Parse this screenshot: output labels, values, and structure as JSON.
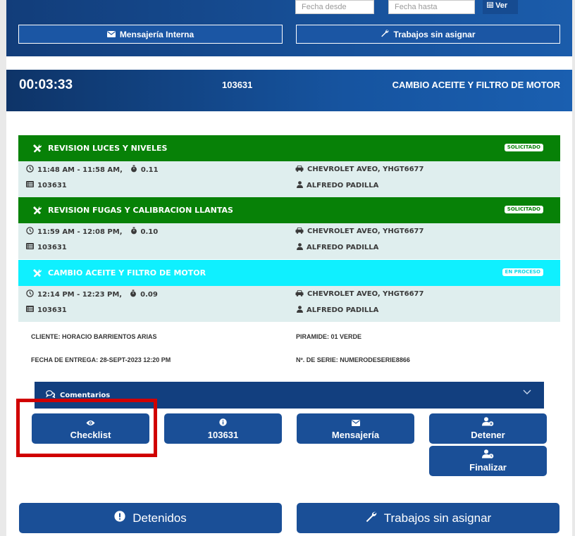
{
  "filters": {
    "date_from_placeholder": "Fecha desde",
    "date_to_placeholder": "Fecha hasta",
    "view_label": "Ver"
  },
  "top_buttons": {
    "messaging": "Mensajería Interna",
    "unassigned": "Trabajos sin asignar"
  },
  "timer_bar": {
    "timer": "00:03:33",
    "order": "103631",
    "title": "CAMBIO ACEITE Y FILTRO DE MOTOR"
  },
  "tasks": [
    {
      "name": "REVISION LUCES Y NIVELES",
      "status": "SOLICITADO",
      "color": "#078107",
      "time_range": "11:48 AM - 11:58 AM,",
      "duration": "0.11",
      "vehicle": "CHEVROLET AVEO, YHGT6677",
      "order": "103631",
      "mechanic": "ALFREDO PADILLA"
    },
    {
      "name": "REVISION FUGAS Y CALIBRACION LLANTAS",
      "status": "SOLICITADO",
      "color": "#078107",
      "time_range": "11:59 AM - 12:08 PM,",
      "duration": "0.10",
      "vehicle": "CHEVROLET AVEO, YHGT6677",
      "order": "103631",
      "mechanic": "ALFREDO PADILLA"
    },
    {
      "name": "CAMBIO ACEITE Y FILTRO DE MOTOR",
      "status": "EN PROCESO",
      "color": "#0ff0ff",
      "time_range": "12:14 PM - 12:23 PM,",
      "duration": "0.09",
      "vehicle": "CHEVROLET AVEO, YHGT6677",
      "order": "103631",
      "mechanic": "ALFREDO PADILLA"
    }
  ],
  "info": {
    "client": "CLIENTE: HORACIO BARRIENTOS ARIAS",
    "pyramid": "PIRAMIDE: 01 VERDE",
    "delivery": "FECHA DE ENTREGA: 28-SEPT-2023 12:20 PM",
    "serial": "Nº. DE SERIE: NUMERODESERIE8866"
  },
  "comments": {
    "label": "Comentarios"
  },
  "actions": {
    "checklist": "Checklist",
    "order": "103631",
    "messaging": "Mensajería",
    "stop": "Detener",
    "finish": "Finalizar"
  },
  "bottom": {
    "stopped": "Detenidos",
    "unassigned": "Trabajos sin asignar"
  }
}
